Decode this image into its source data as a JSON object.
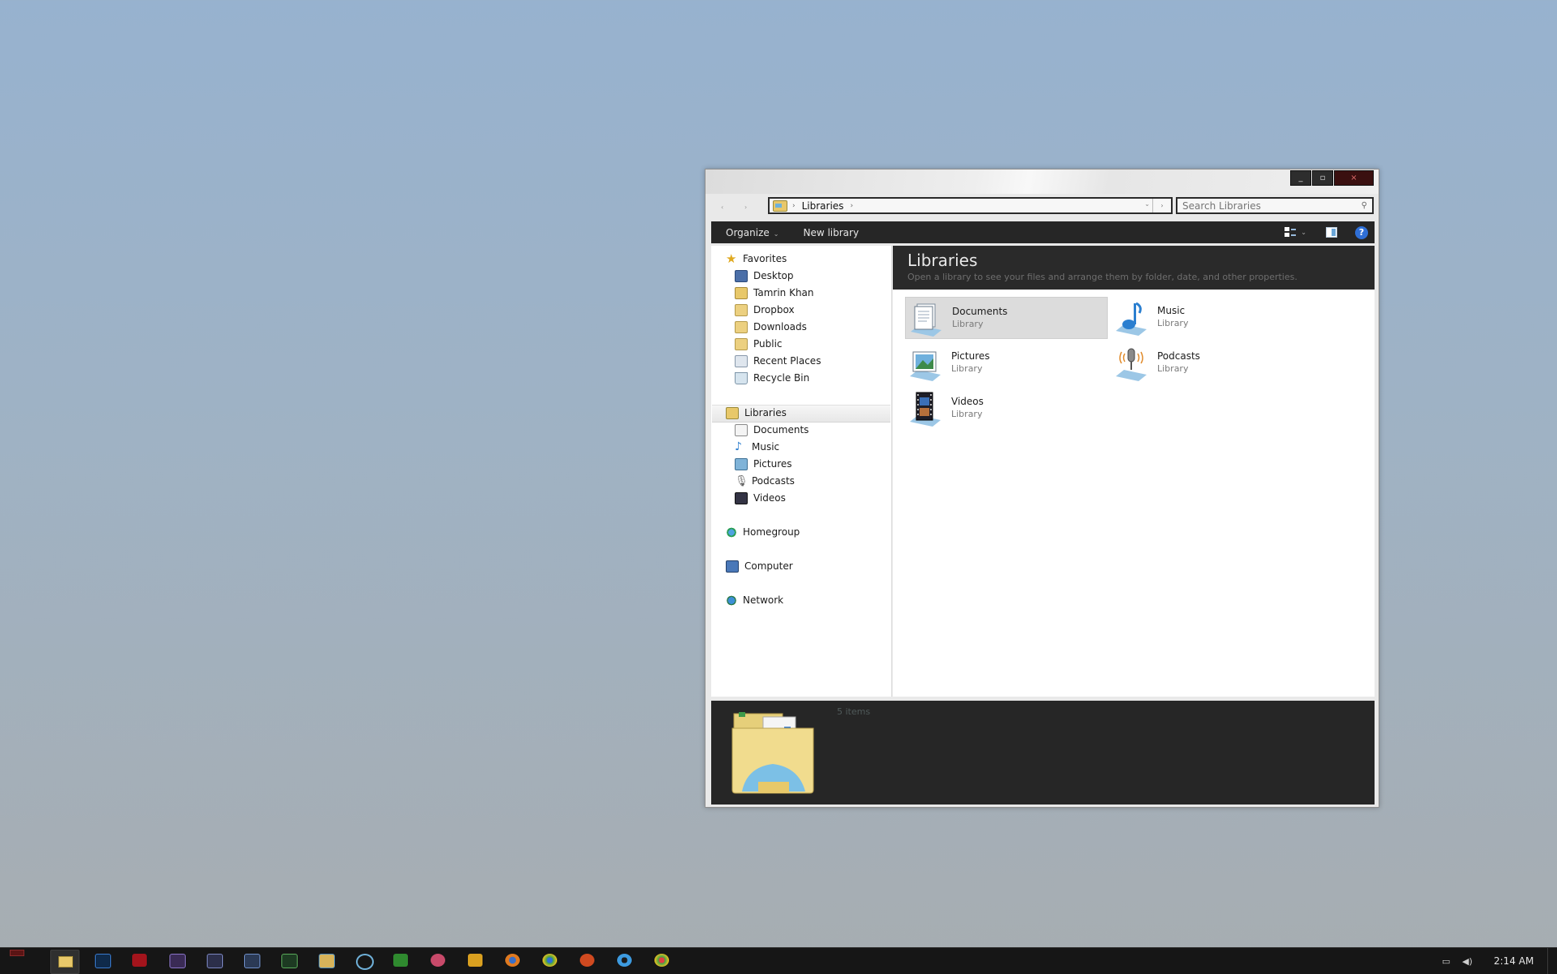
{
  "window": {
    "address": {
      "crumb": "Libraries"
    },
    "search": {
      "placeholder": "Search Libraries"
    },
    "toolbar": {
      "organize": "Organize",
      "new_library": "New library"
    },
    "nav": {
      "favorites": {
        "label": "Favorites",
        "items": [
          "Desktop",
          "Tamrin Khan",
          "Dropbox",
          "Downloads",
          "Public",
          "Recent Places",
          "Recycle Bin"
        ]
      },
      "libraries": {
        "label": "Libraries",
        "items": [
          "Documents",
          "Music",
          "Pictures",
          "Podcasts",
          "Videos"
        ]
      },
      "homegroup": "Homegroup",
      "computer": "Computer",
      "network": "Network"
    },
    "content": {
      "title": "Libraries",
      "subtitle": "Open a library to see your files and arrange them by folder, date, and other properties.",
      "items": [
        {
          "name": "Documents",
          "type": "Library"
        },
        {
          "name": "Music",
          "type": "Library"
        },
        {
          "name": "Pictures",
          "type": "Library"
        },
        {
          "name": "Podcasts",
          "type": "Library"
        },
        {
          "name": "Videos",
          "type": "Library"
        }
      ]
    },
    "details": {
      "count": "5 items"
    }
  },
  "taskbar": {
    "clock": "2:14 AM",
    "apps": [
      "explorer-icon",
      "photoshop-icon",
      "flash-icon",
      "premiere-icon",
      "encore-icon",
      "fireworks-icon",
      "notepad-icon",
      "folder-sync-icon",
      "chain-icon",
      "utorrent-icon",
      "pinwheel-icon",
      "winamp-icon",
      "firefox-icon",
      "chrome-icon",
      "opera-icon",
      "steam-icon",
      "chrome-alt-icon"
    ]
  },
  "colors": {
    "toolbar_bg": "#262626",
    "accent_blue": "#2f6fd6",
    "folder_yellow": "#e8c86a"
  }
}
